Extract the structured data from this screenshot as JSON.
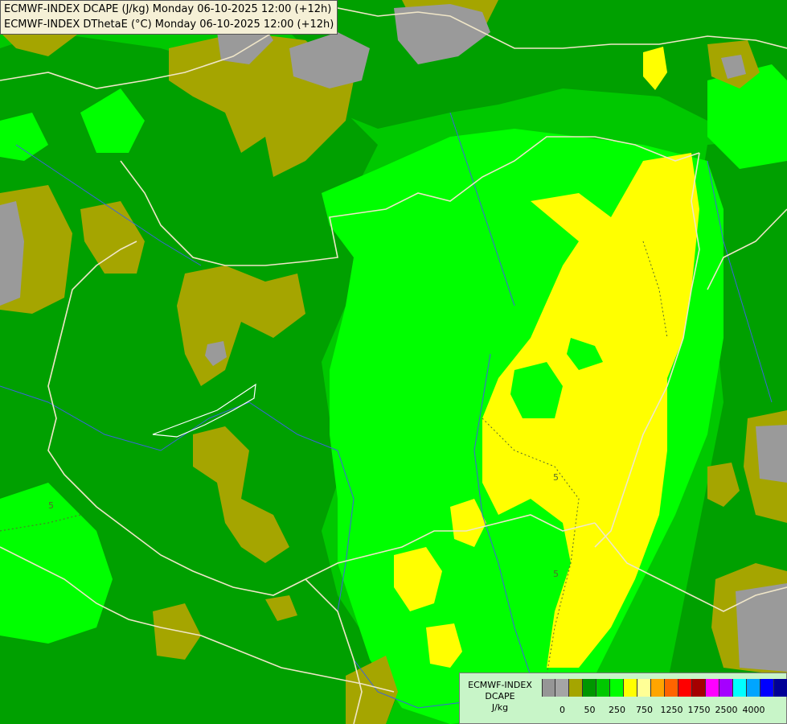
{
  "titles": [
    "ECMWF-INDEX DCAPE (J/kg) Monday 06-10-2025 12:00 (+12h)",
    "ECMWF-INDEX DThetaE (°C) Monday 06-10-2025 12:00 (+12h)"
  ],
  "legend": {
    "line1": "ECMWF-INDEX",
    "line2": "DCAPE",
    "line3": "J/kg",
    "colors": [
      "#969696",
      "#a5a5a5",
      "#a5a500",
      "#009600",
      "#00c800",
      "#00ff00",
      "#ffff00",
      "#ffff96",
      "#ffa500",
      "#ff6400",
      "#ff0000",
      "#a50000",
      "#ff00ff",
      "#a500ff",
      "#00ffff",
      "#00a5ff",
      "#0000ff",
      "#000096"
    ],
    "tick_labels": [
      "0",
      "50",
      "250",
      "750",
      "1250",
      "1750",
      "2500",
      "4000"
    ]
  },
  "contour_labels": [
    "5",
    "5",
    "5"
  ],
  "palette": {
    "grey": "#9a9a9a",
    "olive": "#a5a500",
    "dark_green": "#00a000",
    "mid_green": "#00c800",
    "light_green": "#00ff00",
    "yellow": "#ffff00",
    "border": "#f0e6c8",
    "river": "#3c64dc"
  }
}
